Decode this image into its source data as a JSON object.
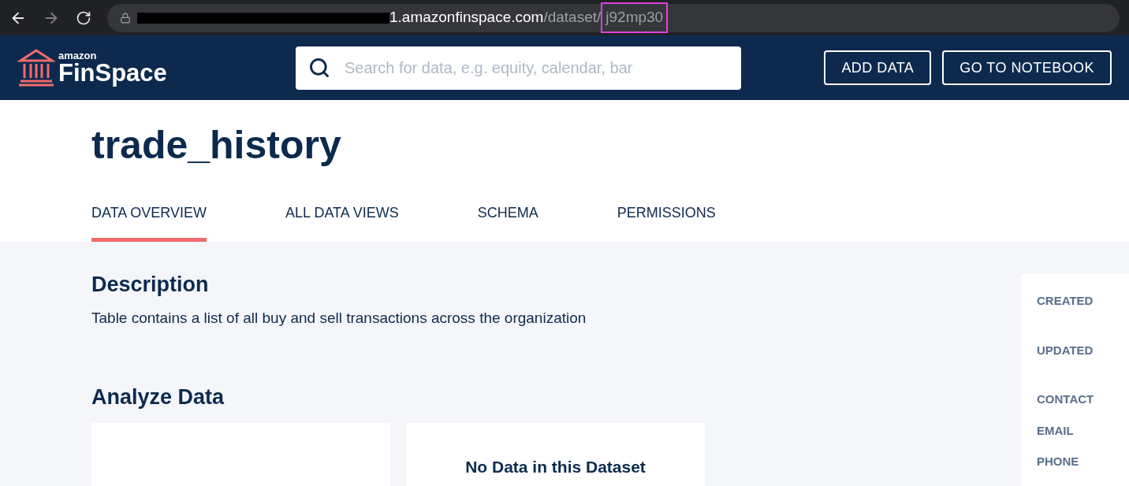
{
  "browser": {
    "url_host": "1.amazonfinspace.com",
    "url_path": "/dataset/",
    "url_id": "j92mp30"
  },
  "header": {
    "logo_small": "amazon",
    "logo_large": "FinSpace",
    "search": {
      "placeholder": "Search for data, e.g. equity, calendar, bar"
    },
    "buttons": [
      "ADD DATA",
      "GO TO NOTEBOOK"
    ]
  },
  "title": "trade_history",
  "tabs": [
    {
      "label": "DATA OVERVIEW",
      "selected": true
    },
    {
      "label": "ALL DATA VIEWS",
      "selected": false
    },
    {
      "label": "SCHEMA",
      "selected": false
    },
    {
      "label": "PERMISSIONS",
      "selected": false
    }
  ],
  "description": {
    "heading": "Description",
    "text": "Table contains a list of all buy and sell transactions across the organization"
  },
  "analyze": {
    "heading": "Analyze Data",
    "cards": [
      {
        "kind": "blank"
      },
      {
        "kind": "message",
        "text": "No Data in this Dataset"
      }
    ]
  },
  "details": [
    "CREATED",
    "UPDATED",
    "CONTACT",
    "EMAIL",
    "PHONE"
  ]
}
